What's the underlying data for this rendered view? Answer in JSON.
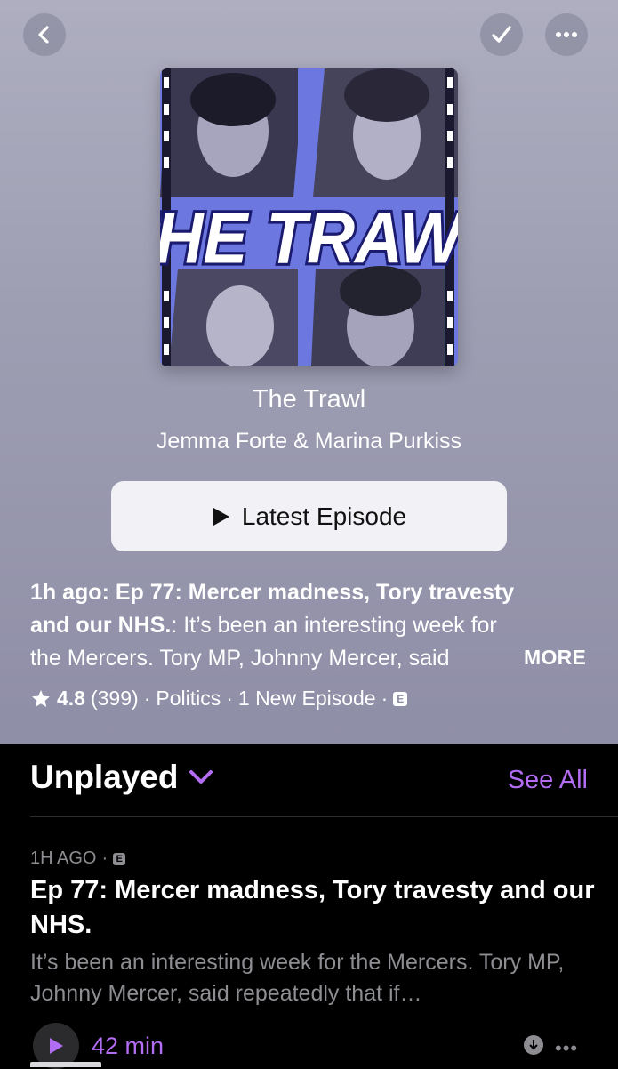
{
  "nav": {
    "back_icon": "chevron-left-icon",
    "followed_icon": "checkmark-icon",
    "more_icon": "ellipsis-icon"
  },
  "artwork": {
    "logo_text": "THE TRAWL"
  },
  "show": {
    "title": "The Trawl",
    "author": "Jemma Forte & Marina Purkiss"
  },
  "latest_button": {
    "label": "Latest Episode",
    "icon": "play-icon"
  },
  "description": {
    "lead": "1h ago: Ep 77: Mercer madness, Tory travesty and our NHS.",
    "line1": "1h ago: Ep 77: Mercer madness, Tory travesty",
    "line2_bold": "and our NHS.",
    "line2_rest": ": It’s been an interesting week for",
    "line3_text": "the Mercers. Tory MP, Johnny Mercer, said",
    "more_label": "MORE"
  },
  "meta": {
    "rating": "4.8",
    "rating_count": "(399)",
    "sep1": "·",
    "category": "Politics",
    "sep2": "·",
    "new_episodes": "1 New Episode",
    "sep3": "·",
    "explicit_badge": "E"
  },
  "unplayed": {
    "title": "Unplayed",
    "see_all": "See All"
  },
  "episode": {
    "time": "1H AGO",
    "sep": "·",
    "explicit_badge": "E",
    "title": "Ep 77: Mercer madness, Tory travesty and our NHS.",
    "description": "It’s been an interesting week for the Mercers. Tory MP, Johnny Mercer, said repeatedly that if…",
    "duration": "42 min"
  },
  "colors": {
    "accent": "#b36cf4",
    "header_bg": "#9d9db2",
    "artwork_blue": "#6c78e0"
  }
}
